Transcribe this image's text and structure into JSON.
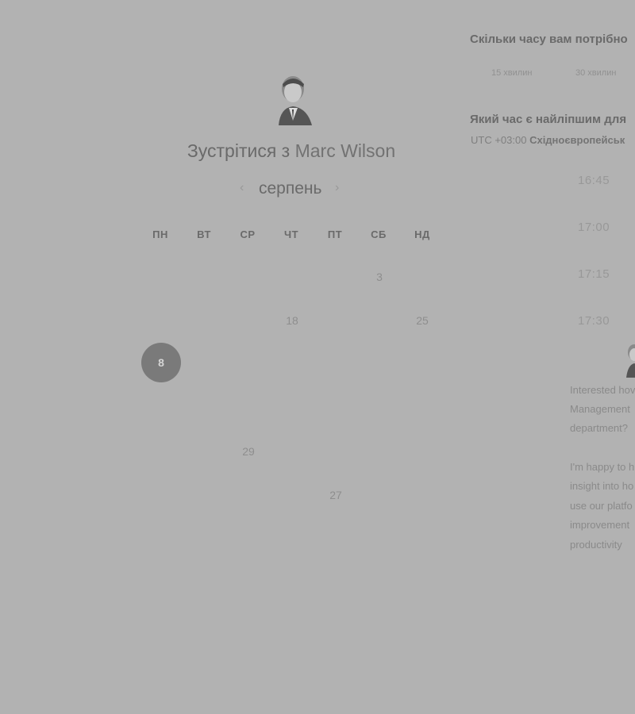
{
  "host": {
    "title_prefix": "Зустрітися з",
    "name": "Marc Wilson"
  },
  "calendar": {
    "month_label": "серпень",
    "prev_icon": "chevron-left-icon",
    "next_icon": "chevron-right-icon",
    "weekdays": [
      "ПН",
      "ВТ",
      "СР",
      "ЧТ",
      "ПТ",
      "СБ",
      "НД"
    ],
    "days": {
      "d3": "3",
      "d18": "18",
      "d25": "25",
      "d29": "29",
      "d27": "27"
    },
    "selected_day": "8"
  },
  "duration": {
    "question": "Скільки часу вам потрібно",
    "options": [
      "15 хвилин",
      "30 хвилин"
    ]
  },
  "time": {
    "question": "Який час є найліпшим для",
    "timezone_offset": "UTC +03:00",
    "timezone_name": "Східноєвропейськ",
    "slots": [
      "16:45",
      "17:00",
      "17:15",
      "17:30"
    ]
  },
  "description": {
    "lines": [
      "Interested hov",
      "Management",
      "department?",
      "I'm happy to h",
      "insight into ho",
      "use our platfo",
      "improvement",
      "productivity"
    ]
  }
}
